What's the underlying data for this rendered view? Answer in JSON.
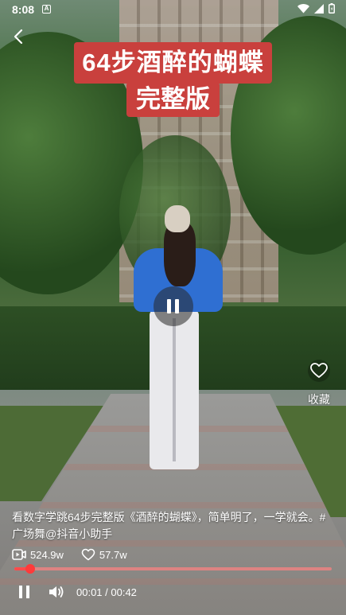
{
  "status_bar": {
    "time": "8:08",
    "notification_glyph": "A"
  },
  "video": {
    "overlay_title_line1": "64步酒醉的蝴蝶",
    "overlay_title_line2": "完整版",
    "description": "看数字学跳64步完整版《酒醉的蝴蝶》，简单明了，一学就会。#广场舞@抖音小助手",
    "views": "524.9w",
    "likes": "57.7w",
    "current_time": "00:01",
    "duration": "00:42",
    "time_display": "00:01 / 00:42",
    "progress_fraction": 0.024
  },
  "actions": {
    "favorite_label": "收藏"
  },
  "icons": {
    "back": "chevron-left-icon",
    "pause_center": "pause-icon",
    "favorite": "heart-outline-icon",
    "views": "video-play-count-icon",
    "likes": "heart-outline-icon",
    "pause": "pause-icon",
    "volume": "speaker-volume-icon"
  },
  "colors": {
    "accent": "#ff4b4b",
    "banner": "#c9403d",
    "track": "#f88282"
  }
}
